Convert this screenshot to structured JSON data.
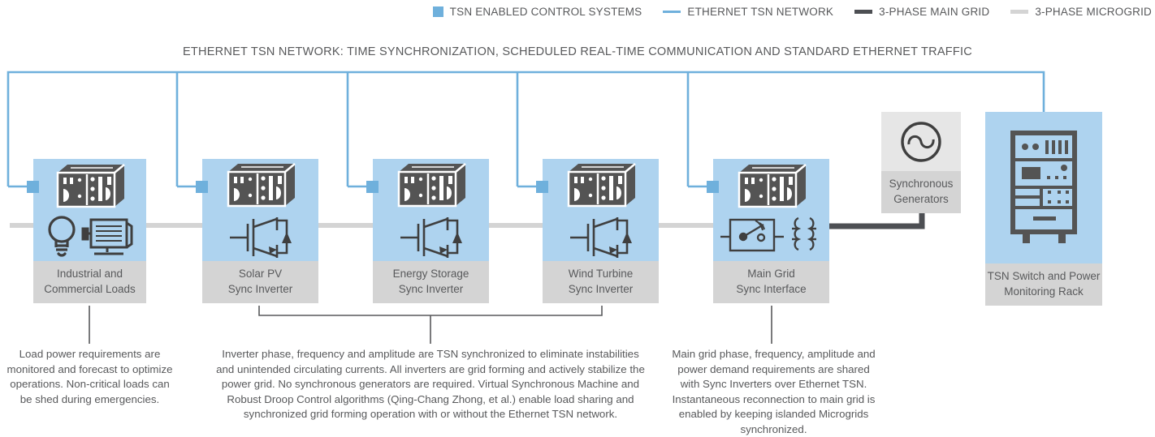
{
  "legend": {
    "items": [
      {
        "label": "TSN ENABLED CONTROL SYSTEMS",
        "swatch": "box",
        "color": "#6fb0dc",
        "icon": "blue-square-swatch"
      },
      {
        "label": "ETHERNET TSN NETWORK",
        "swatch": "line",
        "color": "#6fb0dc",
        "icon": "tsn-line-swatch"
      },
      {
        "label": "3-PHASE MAIN GRID",
        "swatch": "line",
        "color": "#4d4f53",
        "icon": "main-grid-line-swatch"
      },
      {
        "label": "3-PHASE MICROGRID",
        "swatch": "line",
        "color": "#d4d4d4",
        "icon": "microgrid-line-swatch"
      }
    ]
  },
  "headline": "ETHERNET TSN NETWORK: TIME SYNCHRONIZATION, SCHEDULED REAL-TIME COMMUNICATION AND STANDARD ETHERNET TRAFFIC",
  "nodes": [
    {
      "id": "industrial-loads",
      "caption_line1": "Industrial and",
      "caption_line2": "Commercial Loads",
      "icon": "plc-controller-icon",
      "sub_icon": "lightbulb-and-motor-icon",
      "tsn_enabled": true
    },
    {
      "id": "solar-pv-inverter",
      "caption_line1": "Solar PV",
      "caption_line2": "Sync Inverter",
      "icon": "plc-controller-icon",
      "sub_icon": "igbt-transistor-icon",
      "tsn_enabled": true
    },
    {
      "id": "energy-storage-inverter",
      "caption_line1": "Energy Storage",
      "caption_line2": "Sync Inverter",
      "icon": "plc-controller-icon",
      "sub_icon": "igbt-transistor-icon",
      "tsn_enabled": true
    },
    {
      "id": "wind-turbine-inverter",
      "caption_line1": "Wind Turbine",
      "caption_line2": "Sync Inverter",
      "icon": "plc-controller-icon",
      "sub_icon": "igbt-transistor-icon",
      "tsn_enabled": true
    },
    {
      "id": "main-grid-interface",
      "caption_line1": "Main Grid",
      "caption_line2": "Sync Interface",
      "icon": "plc-controller-icon",
      "sub_icon": "breaker-and-transformer-icon",
      "tsn_enabled": true
    },
    {
      "id": "synchronous-generators",
      "caption_line1": "Synchronous",
      "caption_line2": "Generators",
      "icon": "ac-source-sine-icon",
      "tsn_enabled": false
    },
    {
      "id": "tsn-rack",
      "caption_line1": "TSN Switch and Power",
      "caption_line2": "Monitoring Rack",
      "icon": "server-rack-icon",
      "tsn_enabled": true
    }
  ],
  "notes": {
    "loads": "Load power requirements are monitored and forecast to optimize operations. Non-critical loads can be shed during emergencies.",
    "inverters": "Inverter phase, frequency and amplitude are TSN synchronized to eliminate instabilities and unintended circulating currents. All inverters are grid forming and actively stabilize the power grid. No synchronous generators are required. Virtual Synchronous Machine and Robust Droop Control algorithms (Qing-Chang Zhong, et al.) enable load sharing and synchronized grid forming operation with or without the Ethernet TSN network.",
    "main_grid": "Main grid phase, frequency, amplitude and power demand requirements are shared with Sync Inverters over Ethernet TSN. Instantaneous reconnection to main grid is enabled by keeping islanded Microgrids synchronized."
  },
  "colors": {
    "tsn_blue": "#6fb0dc",
    "node_fill": "#aed3ef",
    "caption_fill": "#d4d4d4",
    "main_grid": "#4d4f53",
    "microgrid": "#d4d4d4",
    "text": "#58595b"
  }
}
